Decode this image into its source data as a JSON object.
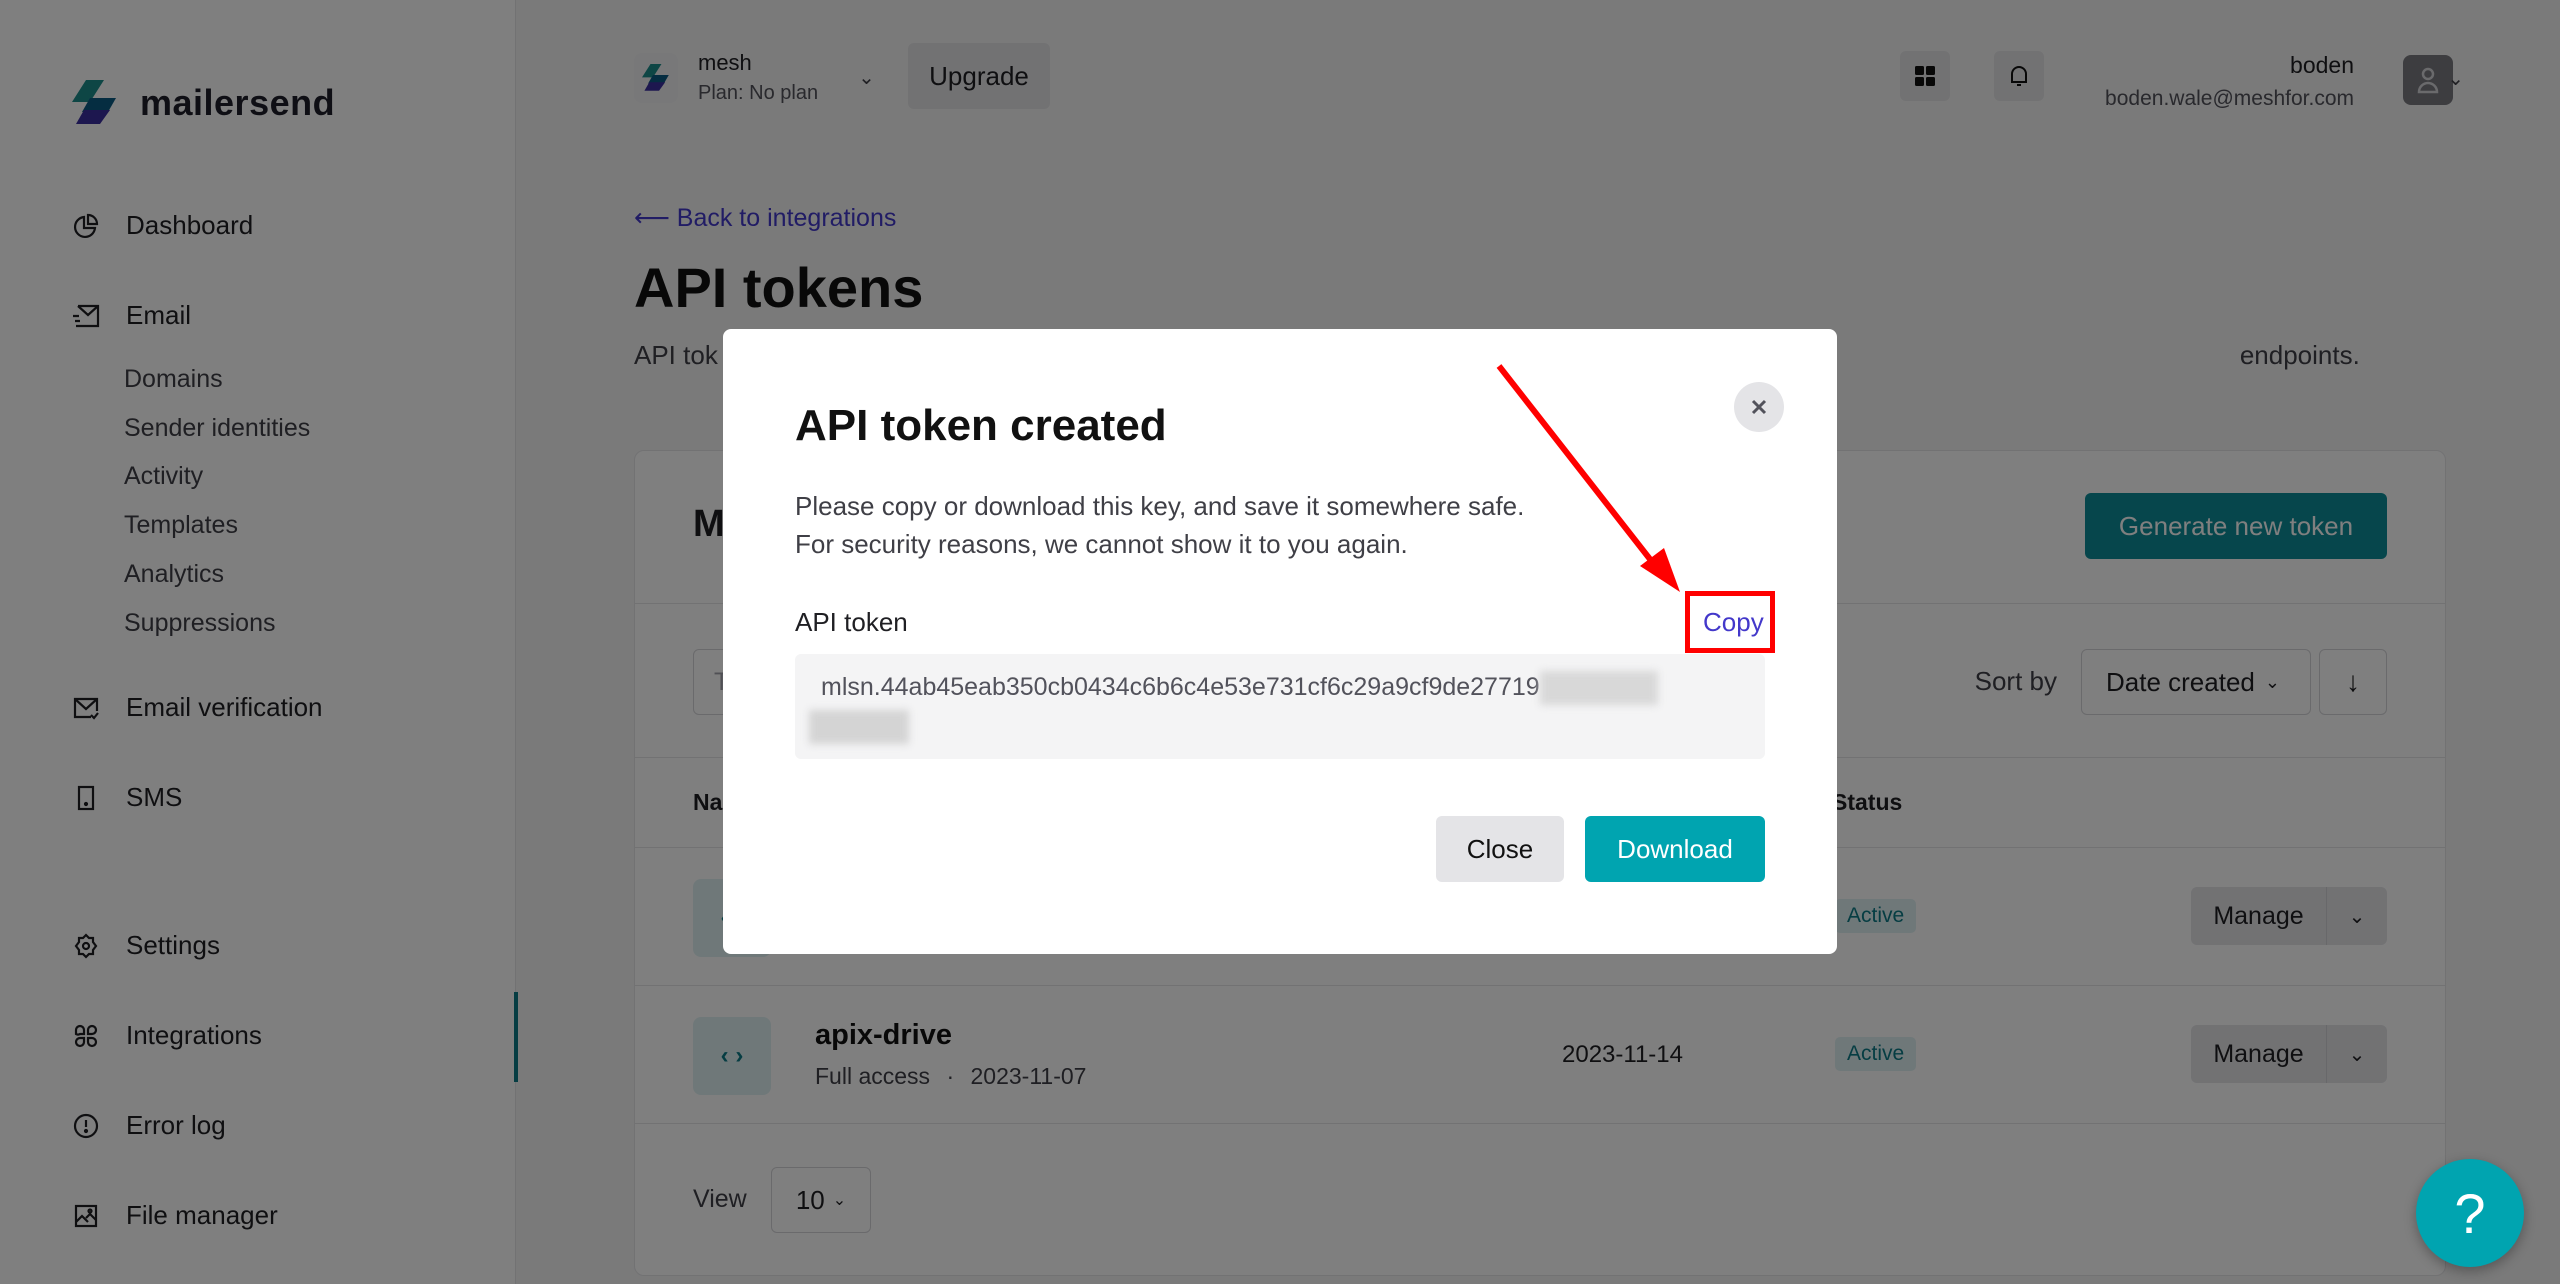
{
  "app": {
    "brand": "mailersend",
    "accent": "#0c8c98",
    "link_color": "#4338ca"
  },
  "sidebar": {
    "items": [
      {
        "label": "Dashboard",
        "icon": "pie-chart-icon"
      },
      {
        "label": "Email",
        "icon": "send-mail-icon"
      },
      {
        "label": "Email verification",
        "icon": "mail-check-icon"
      },
      {
        "label": "SMS",
        "icon": "phone-icon"
      },
      {
        "label": "Settings",
        "icon": "gear-icon"
      },
      {
        "label": "Integrations",
        "icon": "integrations-icon",
        "active": true
      },
      {
        "label": "Error log",
        "icon": "alert-circle-icon"
      },
      {
        "label": "File manager",
        "icon": "image-icon"
      }
    ],
    "email_sub": [
      "Domains",
      "Sender identities",
      "Activity",
      "Templates",
      "Analytics",
      "Suppressions"
    ]
  },
  "topbar": {
    "workspace_name": "mesh",
    "workspace_plan": "Plan: No plan",
    "upgrade_label": "Upgrade",
    "user_name": "boden",
    "user_email": "boden.wale@meshfor.com"
  },
  "page": {
    "back_link": "⟵ Back to integrations",
    "title": "API tokens",
    "description_start": "API tok",
    "description_end": "endpoints.",
    "card_title_start": "M",
    "generate_label": "Generate new token",
    "search_placeholder_start": "T",
    "sort_label": "Sort by",
    "sort_value": "Date created",
    "sort_direction": "↓",
    "columns": {
      "name_start": "Na",
      "status": "Status"
    },
    "rows": [
      {
        "name": "",
        "meta": "",
        "date": "",
        "status": "Active",
        "action": "Manage"
      },
      {
        "name": "apix-drive",
        "access": "Full access",
        "created": "2023-11-07",
        "date": "2023-11-14",
        "status": "Active",
        "action": "Manage"
      }
    ],
    "view_label": "View",
    "view_value": "10"
  },
  "modal": {
    "title": "API token created",
    "line1": "Please copy or download this key, and save it somewhere safe.",
    "line2": "For security reasons, we cannot show it to you again.",
    "token_label": "API token",
    "copy_label": "Copy",
    "token_visible": "mlsn.44ab45eab350cb0434c6b6c4e53e731cf6c29a9cf9de27719",
    "close_label": "Close",
    "download_label": "Download"
  },
  "help": {
    "label": "?"
  }
}
